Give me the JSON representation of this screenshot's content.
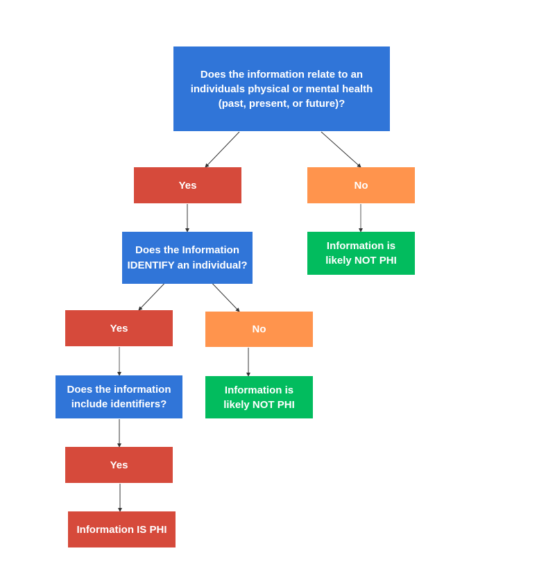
{
  "colors": {
    "question": "#3075d8",
    "yes": "#d64a3b",
    "no": "#ff944d",
    "not_phi": "#02bc5e",
    "is_phi": "#d64a3b",
    "connector": "#333333"
  },
  "nodes": {
    "q1": "Does the information relate to an individuals physical or mental health (past, present, or future)?",
    "yes1": "Yes",
    "no1": "No",
    "q2": "Does the Information IDENTIFY an individual?",
    "not_phi1": "Information is likely NOT PHI",
    "yes2": "Yes",
    "no2": "No",
    "q3": "Does the information include identifiers?",
    "not_phi2": "Information is likely NOT PHI",
    "yes3": "Yes",
    "is_phi": "Information IS PHI"
  },
  "edges": [
    [
      "q1",
      "yes1"
    ],
    [
      "q1",
      "no1"
    ],
    [
      "yes1",
      "q2"
    ],
    [
      "no1",
      "not_phi1"
    ],
    [
      "q2",
      "yes2"
    ],
    [
      "q2",
      "no2"
    ],
    [
      "yes2",
      "q3"
    ],
    [
      "no2",
      "not_phi2"
    ],
    [
      "q3",
      "yes3"
    ],
    [
      "yes3",
      "is_phi"
    ]
  ]
}
